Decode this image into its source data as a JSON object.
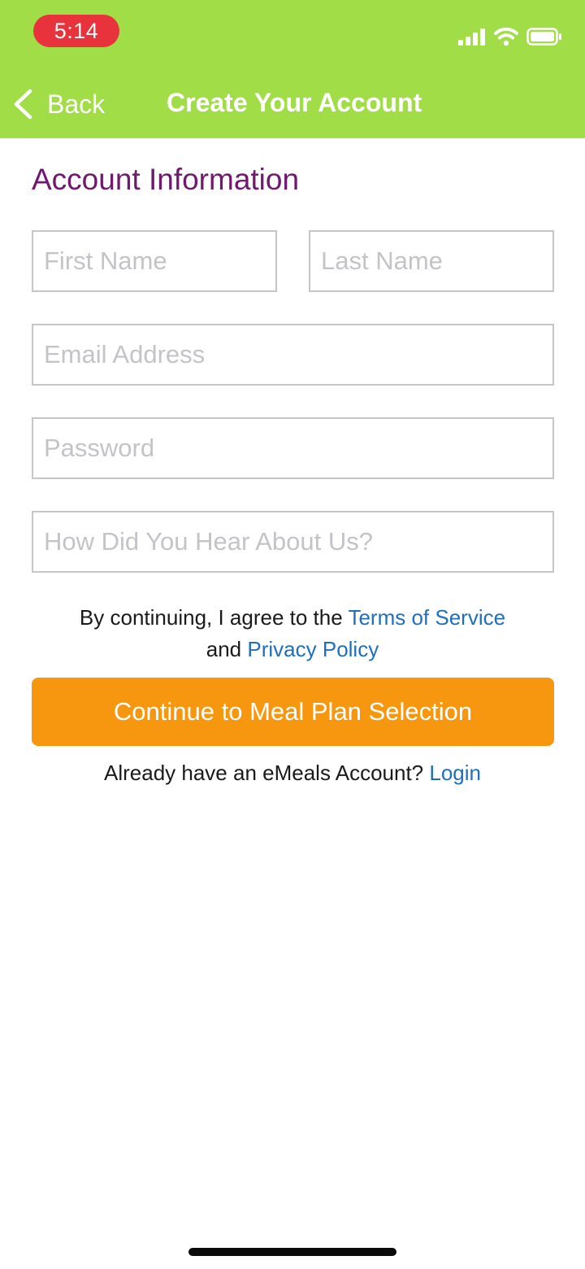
{
  "status_bar": {
    "time": "5:14",
    "icons": [
      "cellular-signal-icon",
      "wifi-icon",
      "battery-icon"
    ]
  },
  "nav": {
    "back_label": "Back",
    "title": "Create Your Account"
  },
  "section": {
    "title": "Account Information"
  },
  "form": {
    "first_name": {
      "placeholder": "First Name",
      "value": ""
    },
    "last_name": {
      "placeholder": "Last Name",
      "value": ""
    },
    "email": {
      "placeholder": "Email Address",
      "value": ""
    },
    "password": {
      "placeholder": "Password",
      "value": ""
    },
    "referral": {
      "placeholder": "How Did You Hear About Us?",
      "value": ""
    }
  },
  "agreement": {
    "prefix": "By continuing, I agree to the",
    "terms_link": "Terms of Service",
    "conjunction": "and",
    "privacy_link": "Privacy Policy"
  },
  "cta": {
    "label": "Continue to Meal Plan Selection"
  },
  "login_prompt": {
    "text": "Already have an eMeals Account?",
    "link": "Login"
  },
  "colors": {
    "header_bg": "#a1dd47",
    "time_pill": "#e8323c",
    "section_title": "#6d1a6f",
    "link": "#1f6fbf",
    "cta_bg": "#f7970f",
    "field_border": "#c6c6c8"
  }
}
